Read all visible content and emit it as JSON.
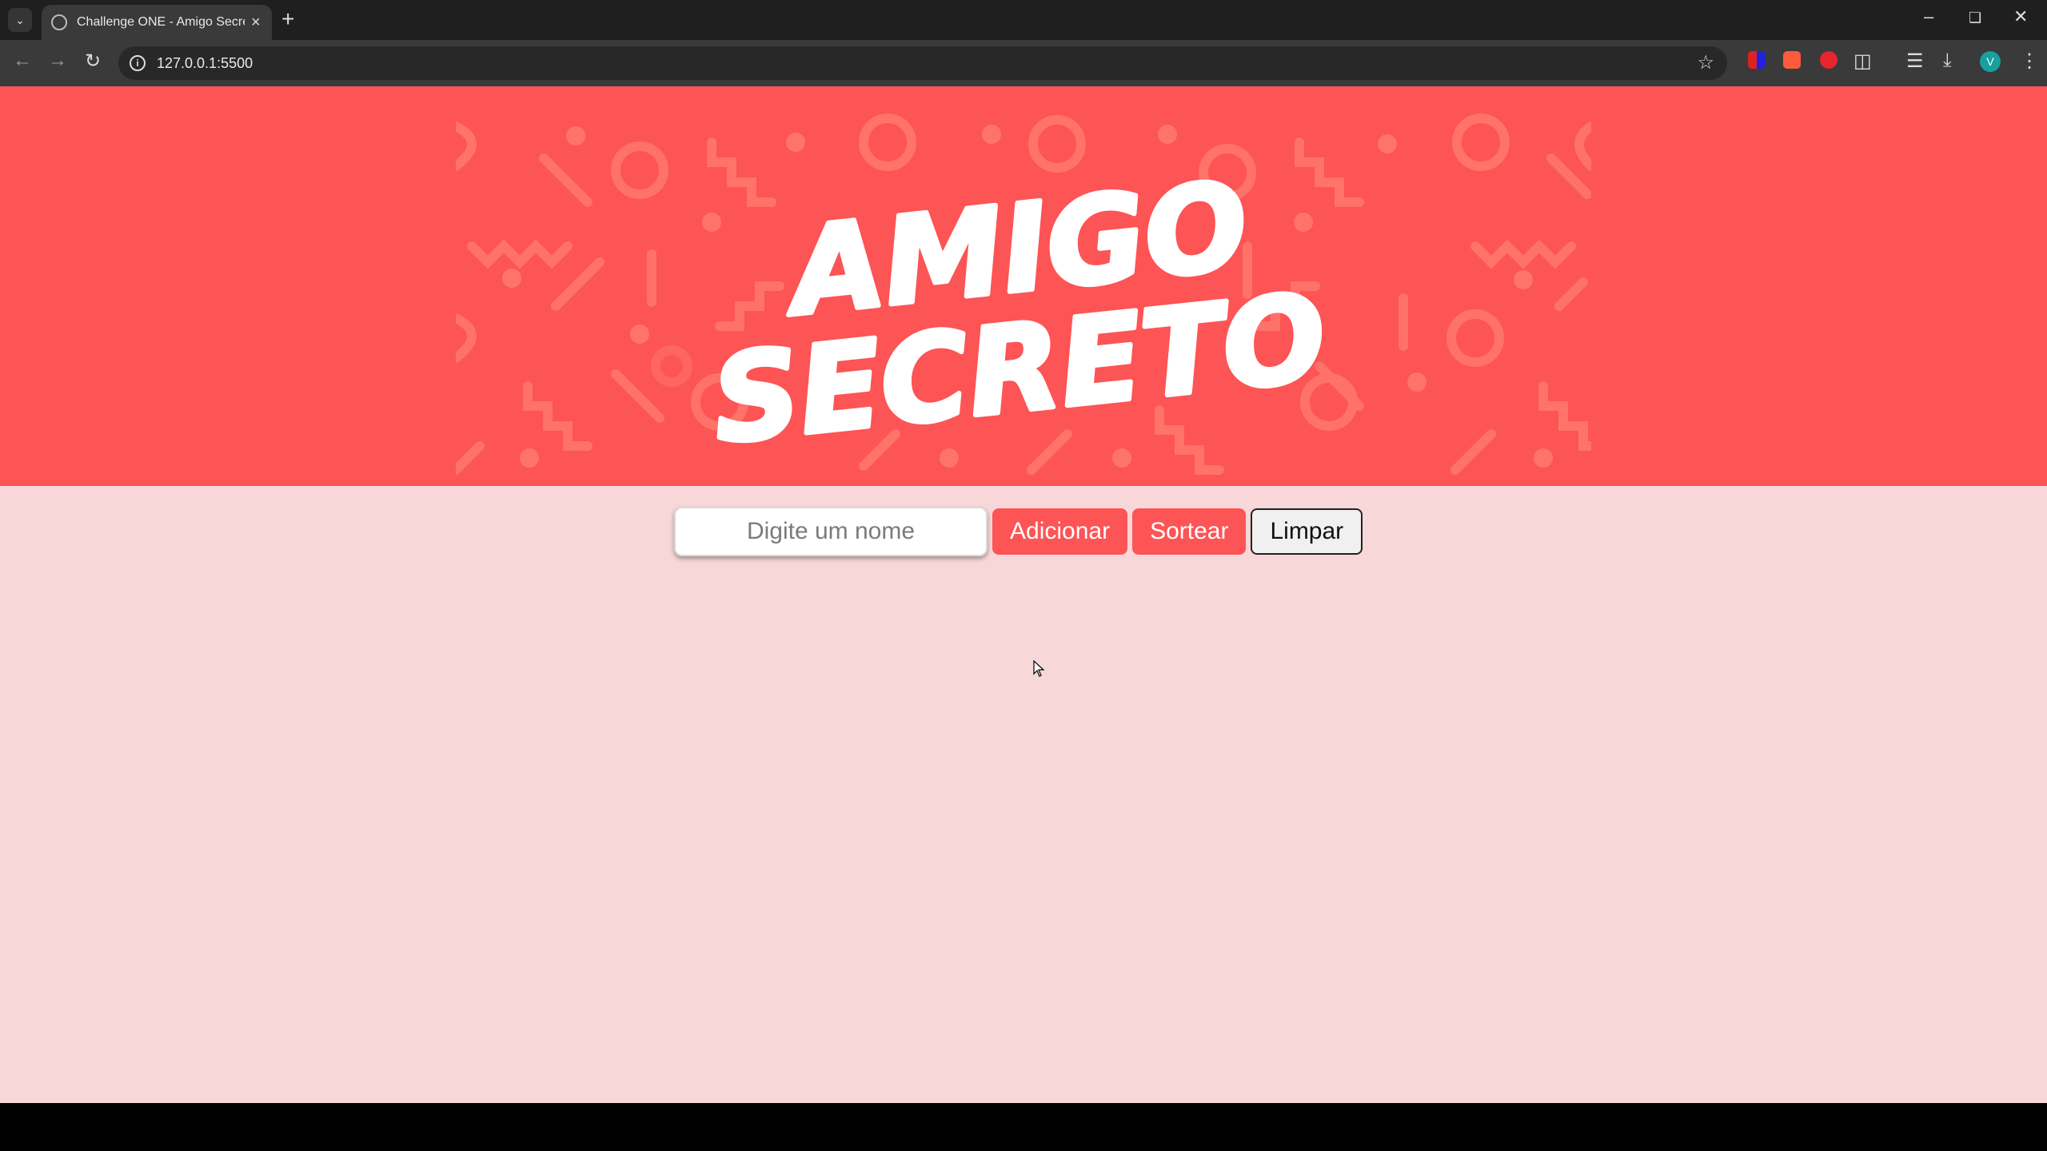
{
  "browser": {
    "tab_title": "Challenge ONE - Amigo Secreto",
    "url": "127.0.0.1:5500",
    "profile_initial": "V"
  },
  "banner": {
    "logo_line1": "AMIGO",
    "logo_line2": "SECRETO",
    "background_color": "#fd5455"
  },
  "form": {
    "name_input": {
      "placeholder": "Digite um nome",
      "value": ""
    },
    "add_label": "Adicionar",
    "draw_label": "Sortear",
    "clear_label": "Limpar"
  },
  "colors": {
    "accent": "#fd5455",
    "page_background": "#f8d7d8"
  }
}
